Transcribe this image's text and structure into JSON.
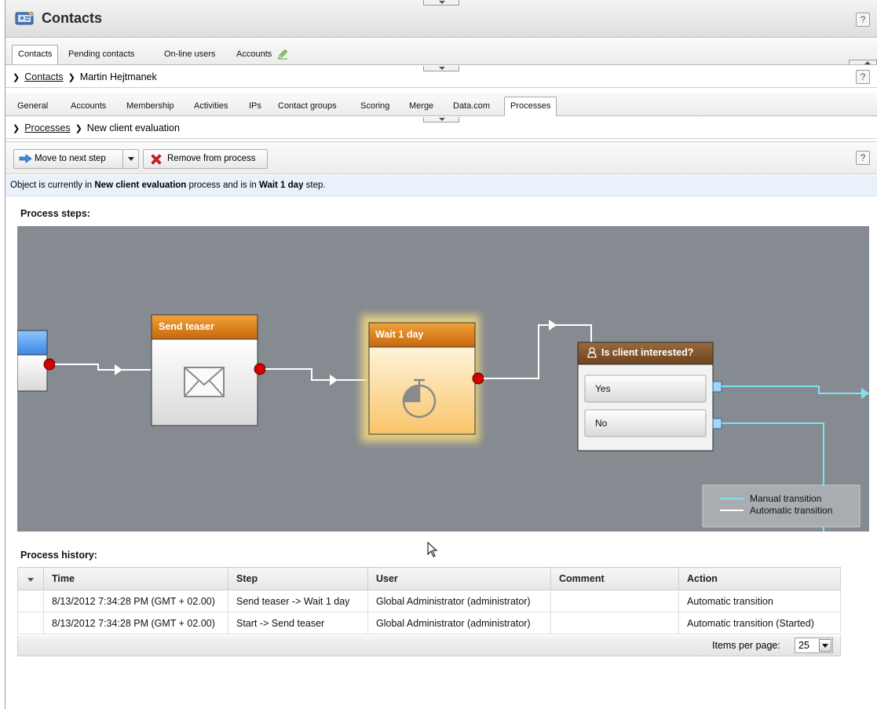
{
  "app": {
    "title": "Contacts",
    "help_label": "?"
  },
  "main_tabs": [
    {
      "label": "Contacts",
      "selected": true
    },
    {
      "label": "Pending contacts",
      "selected": false
    },
    {
      "label": "On-line users",
      "selected": false
    },
    {
      "label": "Accounts",
      "selected": false
    }
  ],
  "breadcrumb1": {
    "link": "Contacts",
    "current": "Martin Hejtmanek"
  },
  "contact_tabs": [
    {
      "label": "General"
    },
    {
      "label": "Accounts"
    },
    {
      "label": "Membership"
    },
    {
      "label": "Activities"
    },
    {
      "label": "IPs"
    },
    {
      "label": "Contact groups"
    },
    {
      "label": "Scoring"
    },
    {
      "label": "Merge"
    },
    {
      "label": "Data.com"
    },
    {
      "label": "Processes",
      "selected": true
    }
  ],
  "breadcrumb2": {
    "link": "Processes",
    "current": "New client evaluation"
  },
  "toolbar": {
    "move_label": "Move to next step",
    "remove_label": "Remove from process"
  },
  "info": {
    "prefix": "Object is currently in ",
    "process": "New client evaluation",
    "middle": " process and is in ",
    "step": "Wait 1 day",
    "suffix": " step."
  },
  "process_steps_heading": "Process steps:",
  "workflow": {
    "steps": [
      {
        "title": "Send teaser",
        "icon": "envelope-icon"
      },
      {
        "title": "Wait 1 day",
        "icon": "stopwatch-icon",
        "current": true
      },
      {
        "title": "Is client interested?",
        "icon": "user-icon",
        "options": [
          "Yes",
          "No"
        ]
      }
    ],
    "legend": {
      "manual": "Manual transition",
      "automatic": "Automatic transition"
    },
    "colors": {
      "canvas": "#868b91",
      "header_orange": "#d7790c",
      "manual": "#7fe3f0",
      "automatic": "#ffffff",
      "connector_red": "#cc0000"
    }
  },
  "history": {
    "heading": "Process history:",
    "columns": [
      "Time",
      "Step",
      "User",
      "Comment",
      "Action"
    ],
    "rows": [
      [
        "8/13/2012 7:34:28 PM (GMT + 02.00)",
        "Send teaser -> Wait 1 day",
        "Global Administrator (administrator)",
        "",
        "Automatic transition"
      ],
      [
        "8/13/2012 7:34:28 PM (GMT + 02.00)",
        "Start -> Send teaser",
        "Global Administrator (administrator)",
        "",
        "Automatic transition (Started)"
      ]
    ],
    "items_per_page_label": "Items per page:",
    "items_per_page": "25"
  }
}
